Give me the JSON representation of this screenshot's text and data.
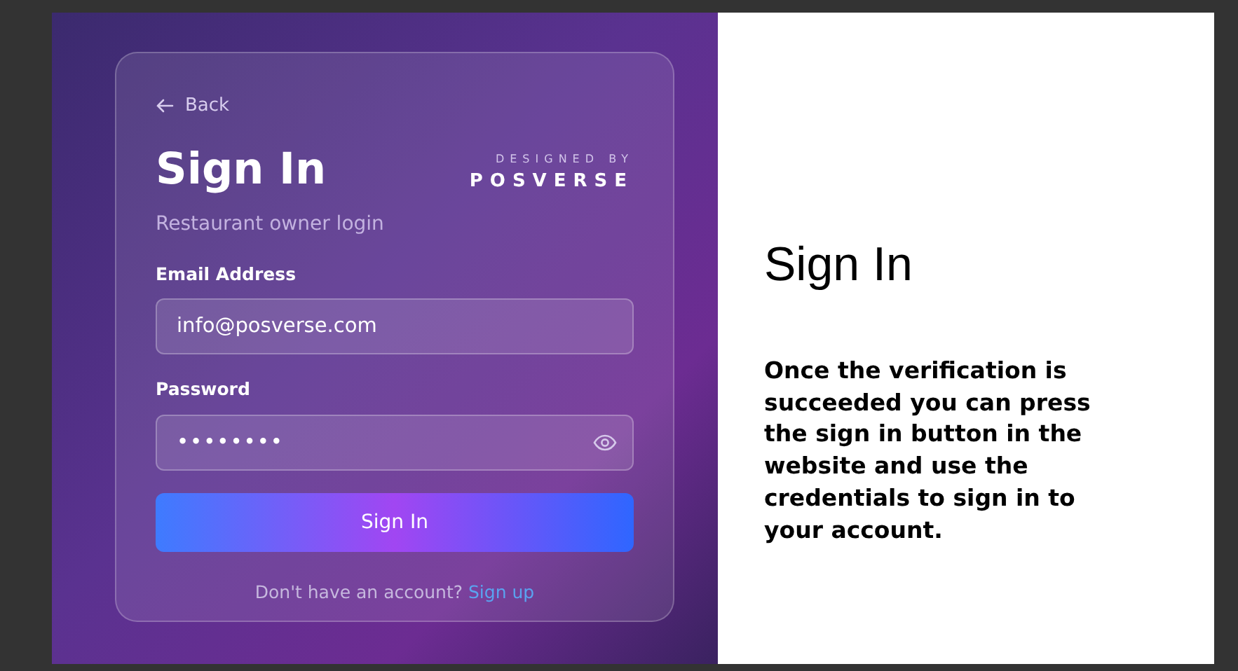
{
  "login_card": {
    "back_link": "Back",
    "title": "Sign In",
    "brand_tagline": "DESIGNED BY",
    "brand_name": "POSVERSE",
    "subtitle": "Restaurant owner login",
    "fields": [
      {
        "label": "Email Address",
        "value": "info@posverse.com",
        "kind": "text"
      },
      {
        "label": "Password",
        "value": "••••••••",
        "kind": "password"
      }
    ],
    "submit_button": "Sign In",
    "footer_text": "Don't have an account?",
    "footer_link": "Sign up"
  },
  "slide_text": {
    "heading": "Sign In",
    "body": "Once the verification is succeeded you can press the sign in button in the website and use the credentials to sign in to your account."
  }
}
